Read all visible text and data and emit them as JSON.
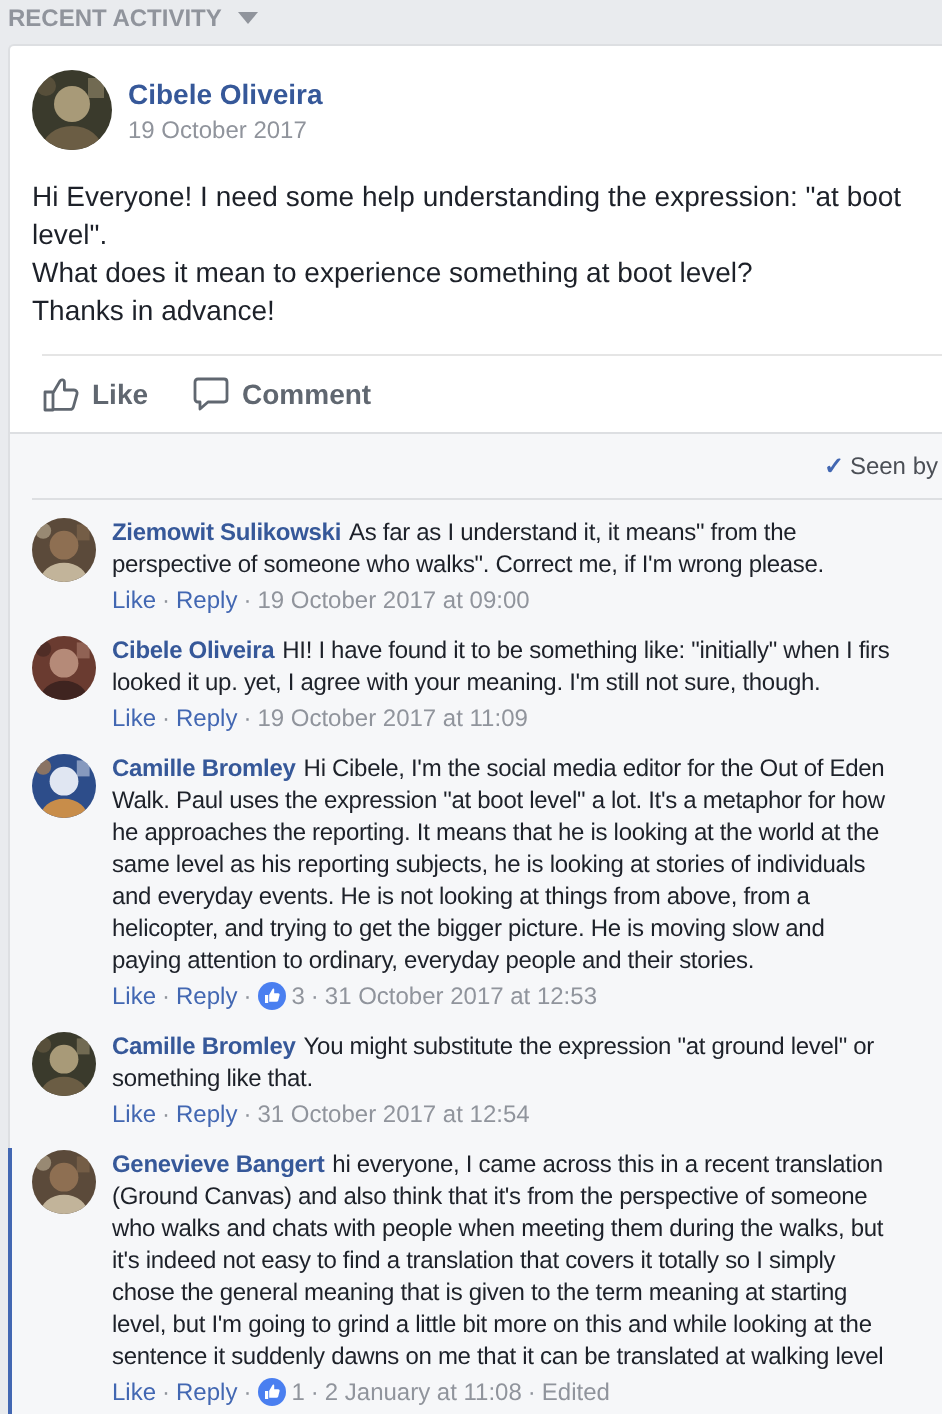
{
  "header": {
    "title": "RECENT ACTIVITY"
  },
  "post": {
    "author": "Cibele Oliveira",
    "date": "19 October 2017",
    "lines": [
      "Hi Everyone! I need some help understanding the expression: \"at boot",
      "level\".",
      "What does it mean to experience something at boot level?",
      "Thanks in advance!"
    ],
    "actions": [
      {
        "kind": "like",
        "label": "Like"
      },
      {
        "kind": "comment",
        "label": "Comment"
      }
    ]
  },
  "seen": {
    "check": "✓",
    "label": "Seen by"
  },
  "separator": "·",
  "comments": [
    {
      "author": "Ziemowit Sulikowski",
      "highlighted": false,
      "lines": [
        "As far as I understand it, it means\" from the",
        "perspective of someone who walks\". Correct me, if I'm wrong please."
      ],
      "meta": [
        {
          "kind": "link",
          "text": "Like"
        },
        {
          "kind": "link",
          "text": "Reply"
        },
        {
          "kind": "time",
          "text": "19 October 2017 at 09:00"
        }
      ]
    },
    {
      "author": "Cibele Oliveira",
      "highlighted": false,
      "lines": [
        "HI! I have found it to be something like: \"initially\" when I firs",
        "looked it up. yet, I agree with your meaning. I'm still not sure, though."
      ],
      "meta": [
        {
          "kind": "link",
          "text": "Like"
        },
        {
          "kind": "link",
          "text": "Reply"
        },
        {
          "kind": "time",
          "text": "19 October 2017 at 11:09"
        }
      ]
    },
    {
      "author": "Camille Bromley",
      "highlighted": false,
      "lines": [
        "Hi Cibele, I'm the social media editor for the Out of Eden",
        "Walk. Paul uses the expression \"at boot level\" a lot. It's a metaphor for how",
        "he approaches the reporting. It means that he is looking at the world at the",
        "same level as his reporting subjects, he is looking at stories of individuals",
        "and everyday events. He is not looking at things from above, from a",
        "helicopter, and trying to get the bigger picture. He is moving slow and",
        "paying attention to ordinary, everyday people and their stories."
      ],
      "meta": [
        {
          "kind": "link",
          "text": "Like"
        },
        {
          "kind": "link",
          "text": "Reply"
        },
        {
          "kind": "reaction",
          "text": "3"
        },
        {
          "kind": "time",
          "text": "31 October 2017 at 12:53"
        }
      ]
    },
    {
      "author": "Camille Bromley",
      "highlighted": false,
      "lines": [
        "You might substitute the expression \"at ground level\" or",
        "something like that."
      ],
      "meta": [
        {
          "kind": "link",
          "text": "Like"
        },
        {
          "kind": "link",
          "text": "Reply"
        },
        {
          "kind": "time",
          "text": "31 October 2017 at 12:54"
        }
      ]
    },
    {
      "author": "Genevieve Bangert",
      "highlighted": true,
      "lines": [
        "hi everyone, I came across this in a recent translation",
        "(Ground Canvas) and also think that it's from the perspective of someone",
        "who walks and chats with people when meeting them during the walks, but",
        "it's indeed not easy to find a translation that covers it totally so I simply",
        "chose the general meaning that is given to the term meaning at starting",
        "level, but I'm going to grind a little bit more on this and while looking at the",
        "sentence it suddenly dawns on me that it can be translated at walking level"
      ],
      "meta": [
        {
          "kind": "link",
          "text": "Like"
        },
        {
          "kind": "link",
          "text": "Reply"
        },
        {
          "kind": "reaction",
          "text": "1"
        },
        {
          "kind": "time",
          "text": "2 January at 11:08"
        },
        {
          "kind": "note",
          "text": "Edited"
        }
      ]
    }
  ]
}
